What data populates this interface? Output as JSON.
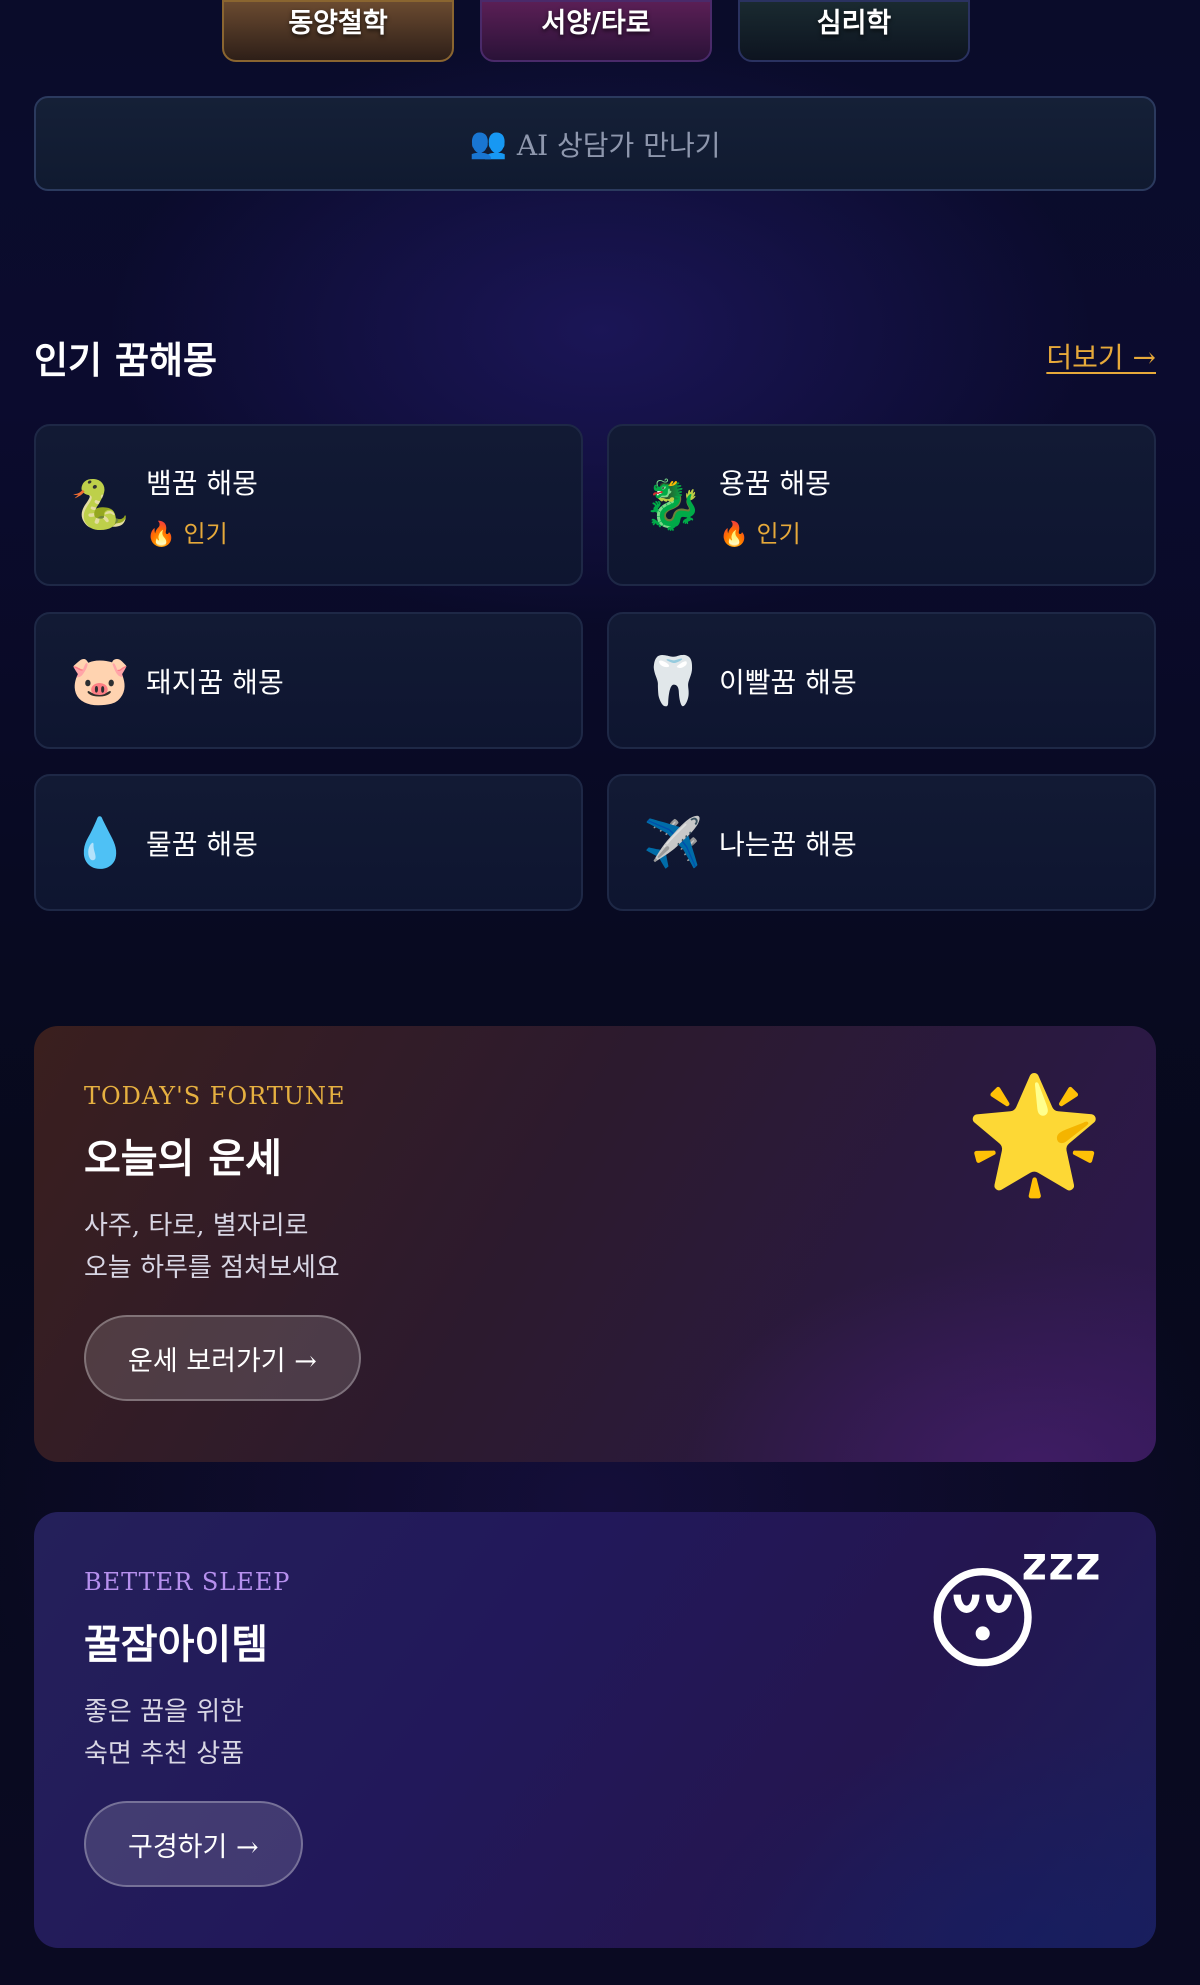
{
  "categories": [
    {
      "label": "동양철학"
    },
    {
      "label": "서양/타로"
    },
    {
      "label": "심리학"
    }
  ],
  "ai_button": {
    "icon": "👥",
    "label": "AI 상담가 만나기"
  },
  "popular": {
    "title": "인기 꿈해몽",
    "more_label": "더보기 →",
    "items": [
      {
        "icon": "🐍",
        "label": "뱀꿈 해몽",
        "badge": "🔥 인기"
      },
      {
        "icon": "🐉",
        "label": "용꿈 해몽",
        "badge": "🔥 인기"
      },
      {
        "icon": "🐷",
        "label": "돼지꿈 해몽"
      },
      {
        "icon": "🦷",
        "label": "이빨꿈 해몽"
      },
      {
        "icon": "💧",
        "label": "물꿈 해몽"
      },
      {
        "icon": "✈️",
        "label": "나는꿈 해몽"
      }
    ]
  },
  "fortune": {
    "kicker": "TODAY'S FORTUNE",
    "title": "오늘의 운세",
    "desc_line1": "사주, 타로, 별자리로",
    "desc_line2": "오늘 하루를 점쳐보세요",
    "cta": "운세 보러가기 →",
    "icon": "🌟"
  },
  "sleep": {
    "kicker": "BETTER SLEEP",
    "title": "꿀잠아이템",
    "desc_line1": "좋은 꿈을 위한",
    "desc_line2": "숙면 추천 상품",
    "cta": "구경하기 →",
    "icon": "😴"
  },
  "colors": {
    "background": "#070a1c",
    "accent_gold": "#e6a93a",
    "accent_purple": "#b690ee"
  }
}
